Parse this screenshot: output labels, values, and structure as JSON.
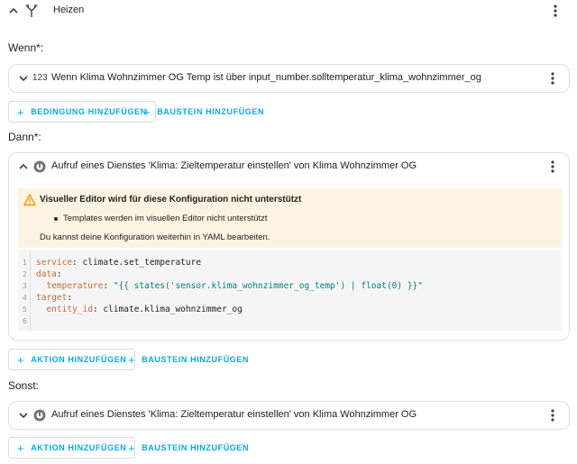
{
  "header": {
    "title": "Heizen",
    "collapse_icon": "chevron-up-icon",
    "type_icon": "choose-fork-icon",
    "menu_icon": "more-vert-icon"
  },
  "when": {
    "label": "Wenn*:",
    "condition": {
      "icon": "numeric-123-icon",
      "icon_text": "123",
      "text": "Wenn Klima Wohnzimmer OG Temp ist über input_number.solltemperatur_klima_wohnzimmer_og"
    },
    "add_condition_label": "BEDINGUNG HINZUFÜGEN",
    "add_block_label": "BAUSTEIN HINZUFÜGEN"
  },
  "then": {
    "label": "Dann*:",
    "action": {
      "icon": "service-icon",
      "text": "Aufruf eines Dienstes 'Klima: Zieltemperatur einstellen' von Klima Wohnzimmer OG",
      "warning": {
        "title": "Visueller Editor wird für diese Konfiguration nicht unterstützt",
        "item": "Templates werden im visuellen Editor nicht unterstützt",
        "footer": "Du kannst deine Konfiguration weiterhin in YAML bearbeiten.",
        "color": "#fdf3e2",
        "icon_color": "#ff9800"
      },
      "yaml": {
        "line_numbers": [
          "1",
          "2",
          "3",
          "4",
          "5",
          "6"
        ],
        "l1_key": "service",
        "l1_val": "climate.set_temperature",
        "l2_key": "data",
        "l3_key": "temperature",
        "l3_val": "\"{{ states('sensor.klima_wohnzimmer_og_temp') | float(0) }}\"",
        "l4_key": "target",
        "l5_key": "entity_id",
        "l5_val": "climate.klima_wohnzimmer_og"
      }
    },
    "add_action_label": "AKTION HINZUFÜGEN",
    "add_block_label": "BAUSTEIN HINZUFÜGEN"
  },
  "else": {
    "label": "Sonst:",
    "action": {
      "icon": "service-icon",
      "text": "Aufruf eines Dienstes 'Klima: Zieltemperatur einstellen' von Klima Wohnzimmer OG"
    },
    "add_action_label": "AKTION HINZUFÜGEN",
    "add_block_label": "BAUSTEIN HINZUFÜGEN"
  },
  "colors": {
    "accent": "#03a9f4",
    "border": "#e0e0e0",
    "yaml_key": "#c76b3a",
    "yaml_string": "#00837e"
  }
}
